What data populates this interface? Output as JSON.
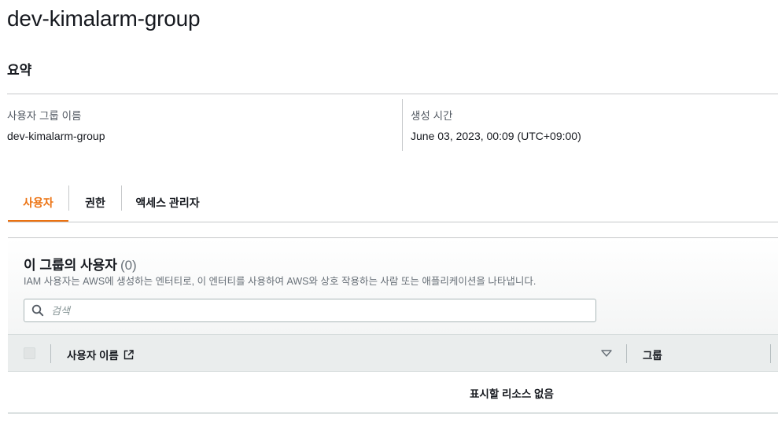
{
  "page": {
    "title": "dev-kimalarm-group"
  },
  "summary": {
    "heading": "요약",
    "group_name_label": "사용자 그룹 이름",
    "group_name_value": "dev-kimalarm-group",
    "created_label": "생성 시간",
    "created_value": "June 03, 2023, 00:09 (UTC+09:00)"
  },
  "tabs": [
    {
      "label": "사용자",
      "active": true
    },
    {
      "label": "권한",
      "active": false
    },
    {
      "label": "액세스 관리자",
      "active": false
    }
  ],
  "users_panel": {
    "title": "이 그룹의 사용자",
    "count": "(0)",
    "description": "IAM 사용자는 AWS에 생성하는 엔터티로, 이 엔터티를 사용하여 AWS와 상호 작용하는 사람 또는 애플리케이션을 나타냅니다.",
    "search_placeholder": "검색",
    "columns": {
      "user_name": "사용자 이름",
      "groups": "그룹"
    },
    "empty_text": "표시할 리소스 없음"
  },
  "colors": {
    "accent": "#ec7211",
    "text": "#16191f",
    "muted": "#687078",
    "header_bg": "#eaeded"
  },
  "icons": [
    "search-icon",
    "external-link-icon",
    "sort-down-icon"
  ]
}
